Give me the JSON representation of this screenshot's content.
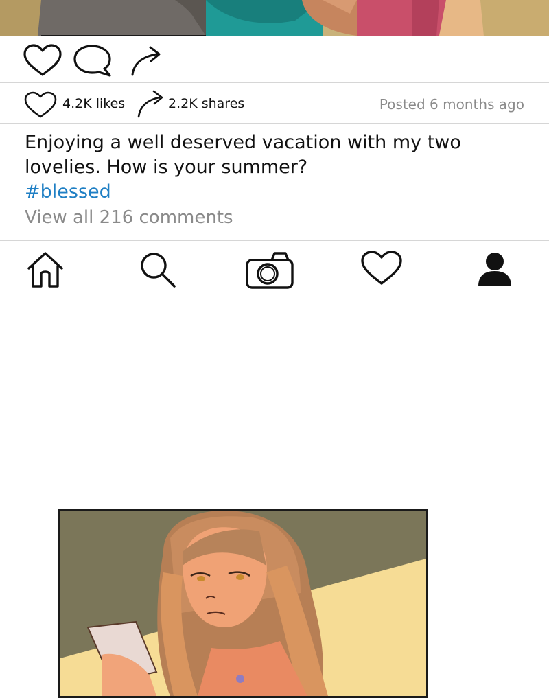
{
  "post": {
    "actions": {
      "like_icon": "heart-icon",
      "comment_icon": "comment-bubble-icon",
      "share_icon": "share-arrow-icon"
    },
    "stats": {
      "likes": "4.2K likes",
      "shares": "2.2K shares",
      "posted": "Posted 6 months ago"
    },
    "caption": "Enjoying a well deserved vacation with my two lovelies. How is your summer?",
    "hashtag": "#blessed",
    "view_comments": "View all 216 comments"
  },
  "nav": {
    "items": [
      {
        "icon": "home-icon"
      },
      {
        "icon": "search-icon"
      },
      {
        "icon": "camera-icon"
      },
      {
        "icon": "heart-icon"
      },
      {
        "icon": "profile-icon"
      }
    ]
  },
  "colors": {
    "hashtag": "#1f7fc4",
    "muted_text": "#8a8a8a",
    "divider": "#d6d6d6"
  }
}
